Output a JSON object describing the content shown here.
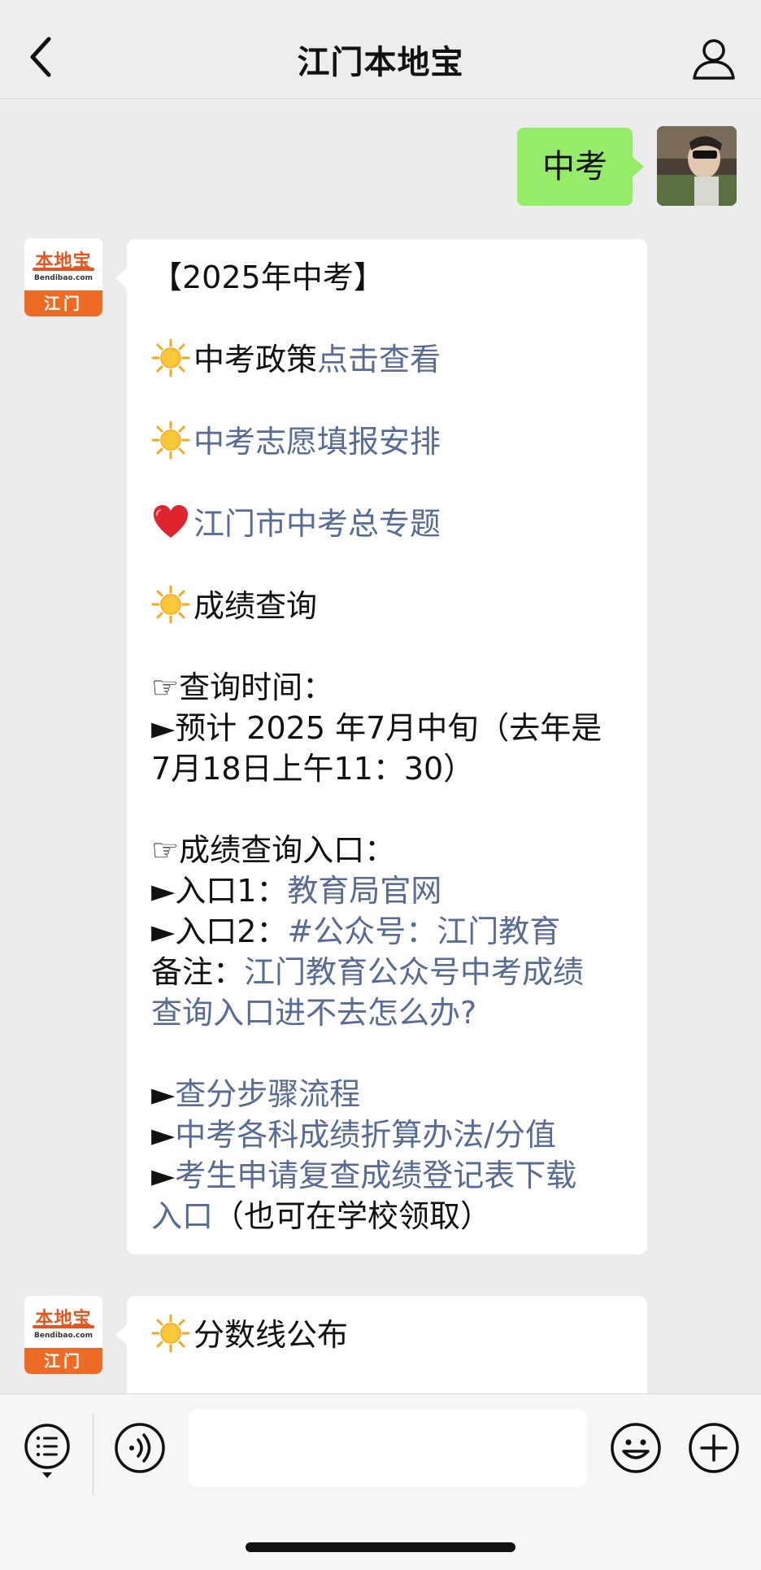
{
  "header": {
    "title": "江门本地宝"
  },
  "outgoing": {
    "text": "中考"
  },
  "bot_avatar": {
    "brand": "本地宝",
    "url": "Bendibao.com",
    "city": "江门"
  },
  "message1": {
    "title": "【2025年中考】",
    "policy_label": "中考政策",
    "policy_link": "点击查看",
    "volunteer_link": "中考志愿填报安排",
    "topic_link": "江门市中考总专题",
    "score_query": "成绩查询",
    "query_time_label": "☞查询时间：",
    "query_time_line1": "►预计 2025 年7月中旬（去年是",
    "query_time_line2": "7月18日上午11：30）",
    "entry_label": "☞成绩查询入口：",
    "entry1_prefix": "►入口1：",
    "entry1_link": "教育局官网",
    "entry2_prefix": "►入口2：",
    "entry2_link": "#公众号：江门教育",
    "note_prefix": "备注：",
    "note_link_line1": "江门教育公众号中考成绩",
    "note_link_line2": "查询入口进不去怎么办?",
    "step_prefix": "►",
    "step_link": "查分步骤流程",
    "conv_prefix": "►",
    "conv_link": "中考各科成绩折算办法/分值",
    "review_prefix": "►",
    "review_link_line1": "考生申请复查成绩登记表下载",
    "review_link_line2": "入口",
    "review_suffix": "（也可在学校领取）"
  },
  "message2": {
    "text": "分数线公布"
  },
  "icons": {
    "back": "chevron-left-icon",
    "profile": "person-icon",
    "sun": "sun-emoji-icon",
    "heart": "red-heart-emoji-icon",
    "menu": "menu-list-icon",
    "voice": "voice-icon",
    "emoji": "smiley-icon",
    "plus": "plus-icon"
  },
  "colors": {
    "link": "#576b95",
    "outgoing_bubble": "#95ec69",
    "brand_orange": "#ef6a24"
  }
}
